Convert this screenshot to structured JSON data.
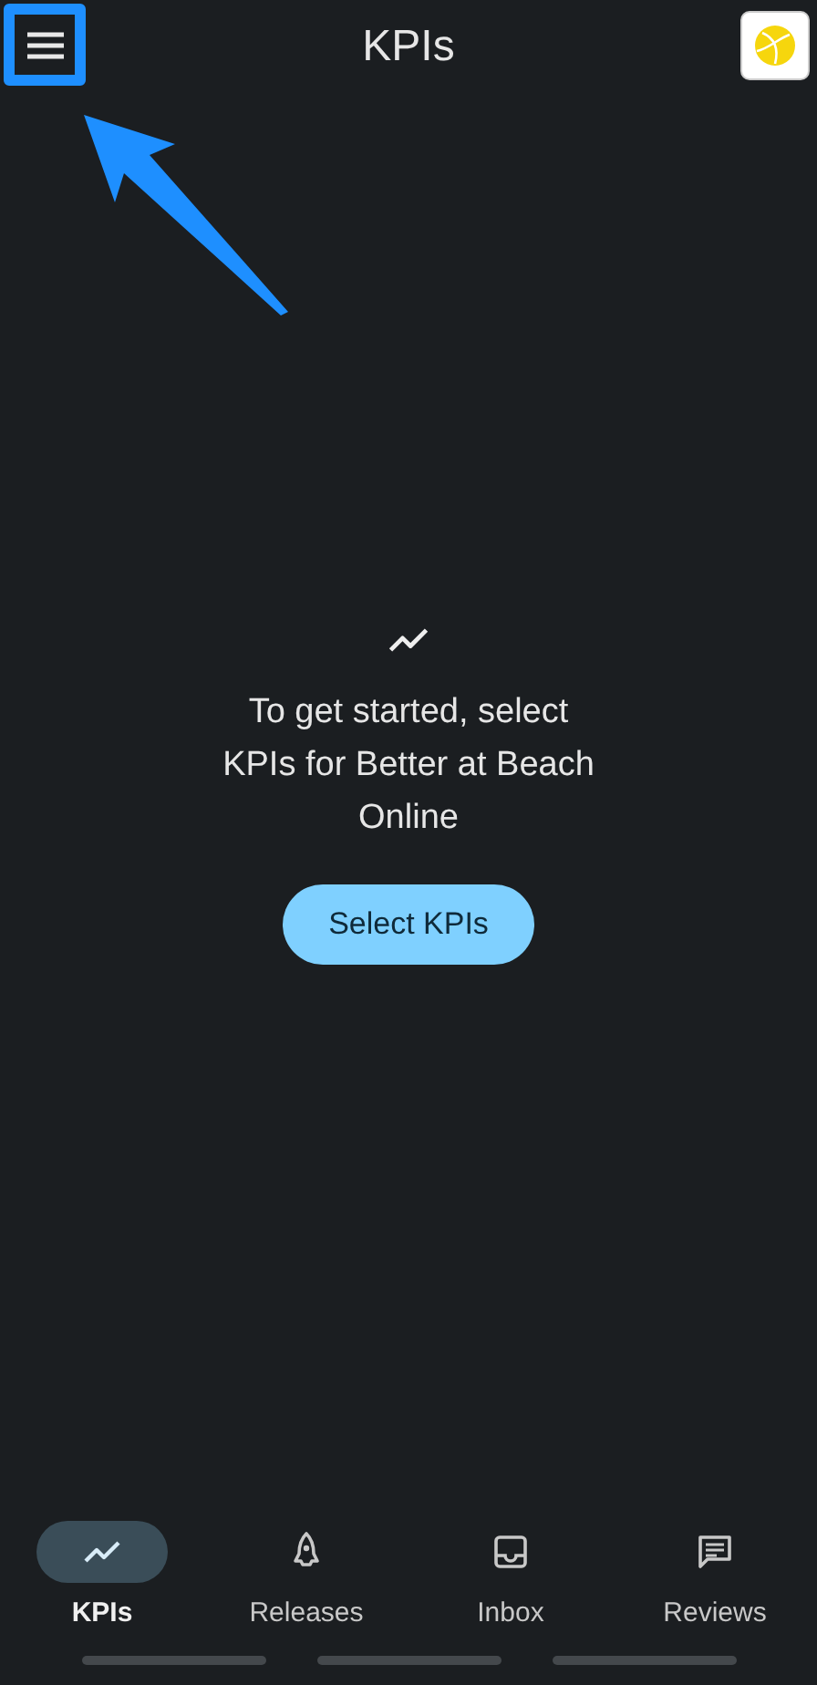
{
  "app_bar": {
    "title": "KPIs"
  },
  "empty_state": {
    "message": "To get started, select KPIs for Better at Beach Online",
    "button": "Select KPIs"
  },
  "nav": [
    {
      "kind": "kpis",
      "label": "KPIs",
      "selected": true
    },
    {
      "kind": "releases",
      "label": "Releases",
      "selected": false
    },
    {
      "kind": "inbox",
      "label": "Inbox",
      "selected": false
    },
    {
      "kind": "reviews",
      "label": "Reviews",
      "selected": false
    }
  ]
}
